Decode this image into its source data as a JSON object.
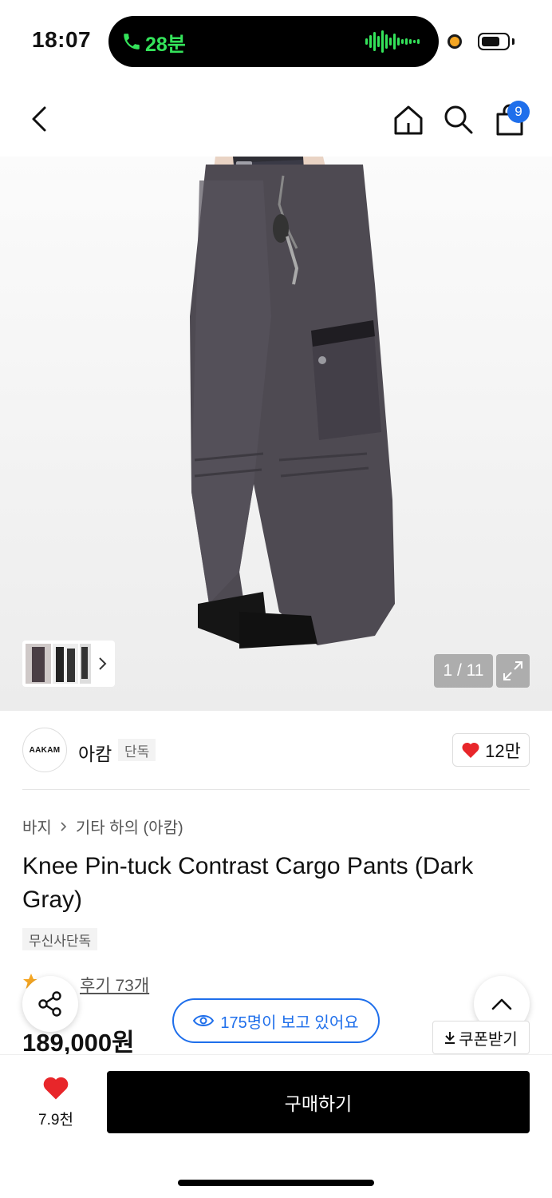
{
  "status_bar": {
    "time": "18:07",
    "call_duration": "28분"
  },
  "header": {
    "cart_count": "9",
    "icons": [
      "back-arrow-icon",
      "home-icon",
      "search-icon",
      "shopping-bag-icon"
    ]
  },
  "gallery": {
    "counter": "1 / 11"
  },
  "brand": {
    "logo_text": "AAKAM",
    "name": "아캄",
    "tag": "단독",
    "likes": "12만"
  },
  "product": {
    "breadcrumb": [
      "바지",
      "기타 하의 (아캄)"
    ],
    "title": "Knee Pin-tuck Contrast Cargo Pants (Dark Gray)",
    "exclusive_badge": "무신사단독",
    "review_link": "후기 73개",
    "price": "189,000원"
  },
  "floating": {
    "viewers": "175명이 보고 있어요",
    "coupon": "쿠폰받기"
  },
  "bottom_bar": {
    "wish_count": "7.9천",
    "buy_label": "구매하기"
  },
  "colors": {
    "accent_blue": "#1f6feb",
    "heart_red": "#e8262a",
    "call_green": "#34e35a",
    "buy_black": "#000000"
  }
}
